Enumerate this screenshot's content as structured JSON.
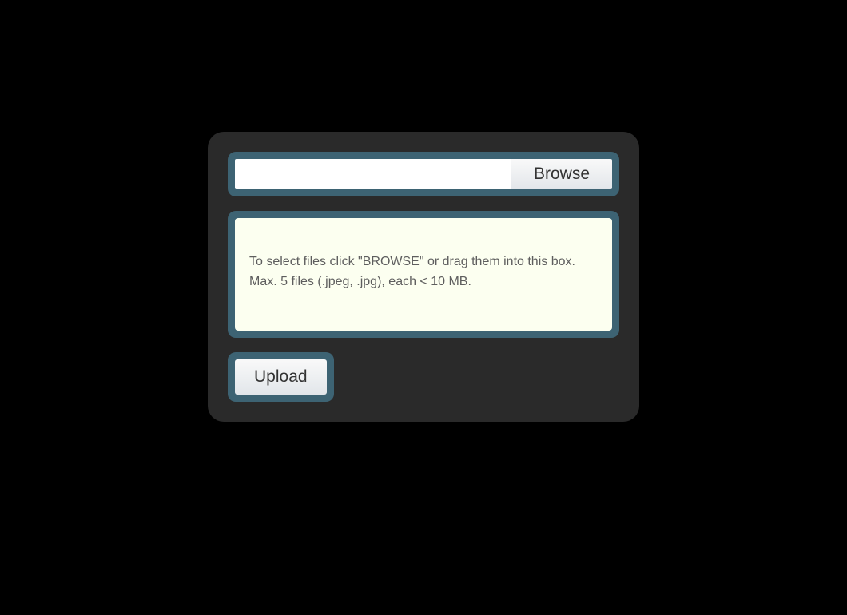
{
  "file_input": {
    "value": "",
    "placeholder": ""
  },
  "browse_button": {
    "label": "Browse"
  },
  "dropzone": {
    "line1": "To select files click \"BROWSE\" or drag them into this box.",
    "line2": "Max. 5 files (.jpeg, .jpg), each < 10 MB."
  },
  "upload_button": {
    "label": "Upload"
  },
  "colors": {
    "panel_bg": "#2a2a2a",
    "border_accent": "#3d6373",
    "dropzone_bg": "#fcfff0",
    "button_bg_top": "#f9f9f9",
    "button_bg_bottom": "#e2e6ea"
  }
}
